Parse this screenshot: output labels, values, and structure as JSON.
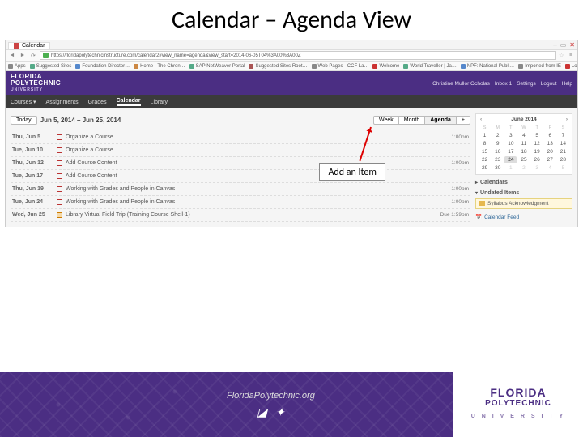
{
  "slide_title": "Calendar – Agenda View",
  "browser": {
    "tab_title": "Calendar",
    "url": "https://floridapolytechnicinstructure.com/calendar2#view_name=agenda&view_start=2014-06-05T04%3A00%3A00Z",
    "bookmarks": [
      "Apps",
      "Suggested Sites",
      "Foundation Director…",
      "Home - The Chron…",
      "SAP NetWeaver Portal",
      "Suggested Sites Root…",
      "Web Pages - CCF La…",
      "Welcome",
      "World Traveller | Ja…",
      "NPF: National Publi…",
      "Imported from IE",
      "Log In to Canvas"
    ]
  },
  "header": {
    "logo_top": "FLORIDA",
    "logo_mid": "POLYTECHNIC",
    "logo_bot": "UNIVERSITY",
    "user_items": [
      "Christine Mullor Ocholas",
      "Inbox 1",
      "Settings",
      "Logout",
      "Help"
    ]
  },
  "nav": [
    "Courses ▾",
    "Assignments",
    "Grades",
    "Calendar",
    "Library"
  ],
  "nav_active_index": 3,
  "toolbar": {
    "today": "Today",
    "range": "Jun 5, 2014 – Jun 25, 2014",
    "views": [
      "Week",
      "Month",
      "Agenda",
      "+"
    ],
    "active_view": 2
  },
  "callout": "Add an Item",
  "agenda": [
    {
      "date": "Thu, Jun 5",
      "title": "Organize a Course",
      "time": "1:00pm",
      "icon": "box"
    },
    {
      "date": "Tue, Jun 10",
      "title": "Organize a Course",
      "time": "",
      "icon": "box"
    },
    {
      "date": "Thu, Jun 12",
      "title": "Add Course Content",
      "time": "1:00pm",
      "icon": "box"
    },
    {
      "date": "Tue, Jun 17",
      "title": "Add Course Content",
      "time": "",
      "icon": "box"
    },
    {
      "date": "Thu, Jun 19",
      "title": "Working with Grades and People in Canvas",
      "time": "1:00pm",
      "icon": "box"
    },
    {
      "date": "Tue, Jun 24",
      "title": "Working with Grades and People in Canvas",
      "time": "1:00pm",
      "icon": "box"
    },
    {
      "date": "Wed, Jun 25",
      "title": "Library Virtual Field Trip (Training Course Shell-1)",
      "time": "Due 1:59pm",
      "icon": "orange"
    }
  ],
  "mini_calendar": {
    "label": "June 2014",
    "today": 24,
    "weekdays": [
      "S",
      "M",
      "T",
      "W",
      "T",
      "F",
      "S"
    ],
    "weeks": [
      [
        1,
        2,
        3,
        4,
        5,
        6,
        7
      ],
      [
        8,
        9,
        10,
        11,
        12,
        13,
        14
      ],
      [
        15,
        16,
        17,
        18,
        19,
        20,
        21
      ],
      [
        22,
        23,
        24,
        25,
        26,
        27,
        28
      ],
      [
        29,
        30,
        1,
        2,
        3,
        4,
        5
      ]
    ],
    "dim_from_row": 4,
    "dim_from_col": 2
  },
  "side": {
    "calendars_hdr": "Calendars",
    "undated_hdr": "Undated Items",
    "undated_item": "Syllabus Acknowledgment",
    "feed": "Calendar Feed"
  },
  "footer": {
    "site": "FloridaPolytechnic.org",
    "logo_top": "FLORIDA",
    "logo_mid": "POLYTECHNIC",
    "logo_bot": "U N I V E R S I T Y"
  }
}
